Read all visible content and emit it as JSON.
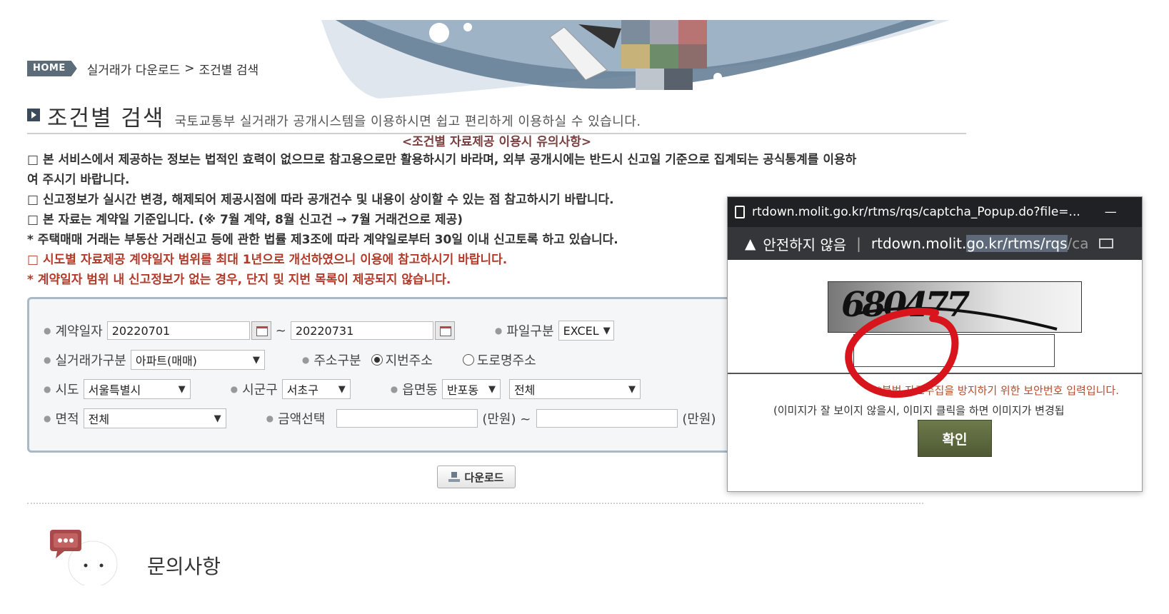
{
  "breadcrumb": {
    "home": "HOME",
    "section": "실거래가 다운로드",
    "separator": ">",
    "current": "조건별 검색"
  },
  "page": {
    "title": "조건별 검색",
    "description": "국토교통부 실거래가 공개시스템을 이용하시면 쉽고 편리하게 이용하실 수 있습니다."
  },
  "notice": {
    "title": "<조건별 자료제공 이용시 유의사항>",
    "lines": [
      "□ 본 서비스에서 제공하는 정보는 법적인 효력이 없으므로 참고용으로만 활용하시기 바라며, 외부 공개시에는 반드시 신고일 기준으로 집계되는 공식통계를 이용하",
      "여 주시기 바랍니다.",
      "□ 신고정보가 실시간 변경, 해제되어 제공시점에 따라 공개건수 및 내용이 상이할 수 있는 점 참고하시기 바랍니다.",
      "□ 본 자료는 계약일 기준입니다. (※ 7월 계약, 8월 신고건 → 7월 거래건으로 제공)",
      "* 주택매매 거래는 부동산 거래신고 등에 관한 법률 제3조에 따라 계약일로부터 30일 이내 신고토록 하고 있습니다.",
      "□ 시도별 자료제공 계약일자 범위를 최대 1년으로 개선하였으니 이용에 참고하시기 바랍니다.",
      "* 계약일자 범위 내 신고정보가 없는 경우, 단지 및 지번 목록이 제공되지 않습니다."
    ]
  },
  "search": {
    "contract_date_label": "계약일자",
    "date_from": "20220701",
    "date_tilde": "~",
    "date_to": "20220731",
    "file_type_label": "파일구분",
    "file_type_value": "EXCEL",
    "trade_type_label": "실거래가구분",
    "trade_type_value": "아파트(매매)",
    "address_type_label": "주소구분",
    "address_option_jibun": "지번주소",
    "address_option_road": "도로명주소",
    "sido_label": "시도",
    "sido_value": "서울특별시",
    "sigungu_label": "시군구",
    "sigungu_value": "서초구",
    "eupmyeondong_label": "읍면동",
    "eupmyeondong_value": "반포동",
    "extra_value": "전체",
    "area_label": "면적",
    "area_value": "전체",
    "amount_label": "금액선택",
    "amount_unit_1": "(만원) ~",
    "amount_unit_2": "(만원)"
  },
  "download_label": "다운로드",
  "inquiry": {
    "title": "문의사항"
  },
  "popup": {
    "title_url": "rtdown.molit.go.kr/rtms/rqs/captcha_Popup.do?file=...",
    "minimize": "—",
    "security_warning": "안전하지 않음",
    "url_sep": "|",
    "url_prefix": "rtdown.molit.",
    "url_highlight": "go.kr/rtms/rqs",
    "url_suffix": "/ca",
    "captcha_text": "680477",
    "notice": "*불법 자료수집을 방지하기 위한 보안번호 입력입니다.",
    "help": "(이미지가 잘 보이지 않을시, 이미지 클릭을 하면 이미지가 변경됩",
    "confirm": "확인"
  },
  "colors": {
    "accent_red": "#b23a2a",
    "box_border": "#a9b9c6",
    "confirm_green": "#5a6638",
    "annotation_red": "#d8141c"
  }
}
